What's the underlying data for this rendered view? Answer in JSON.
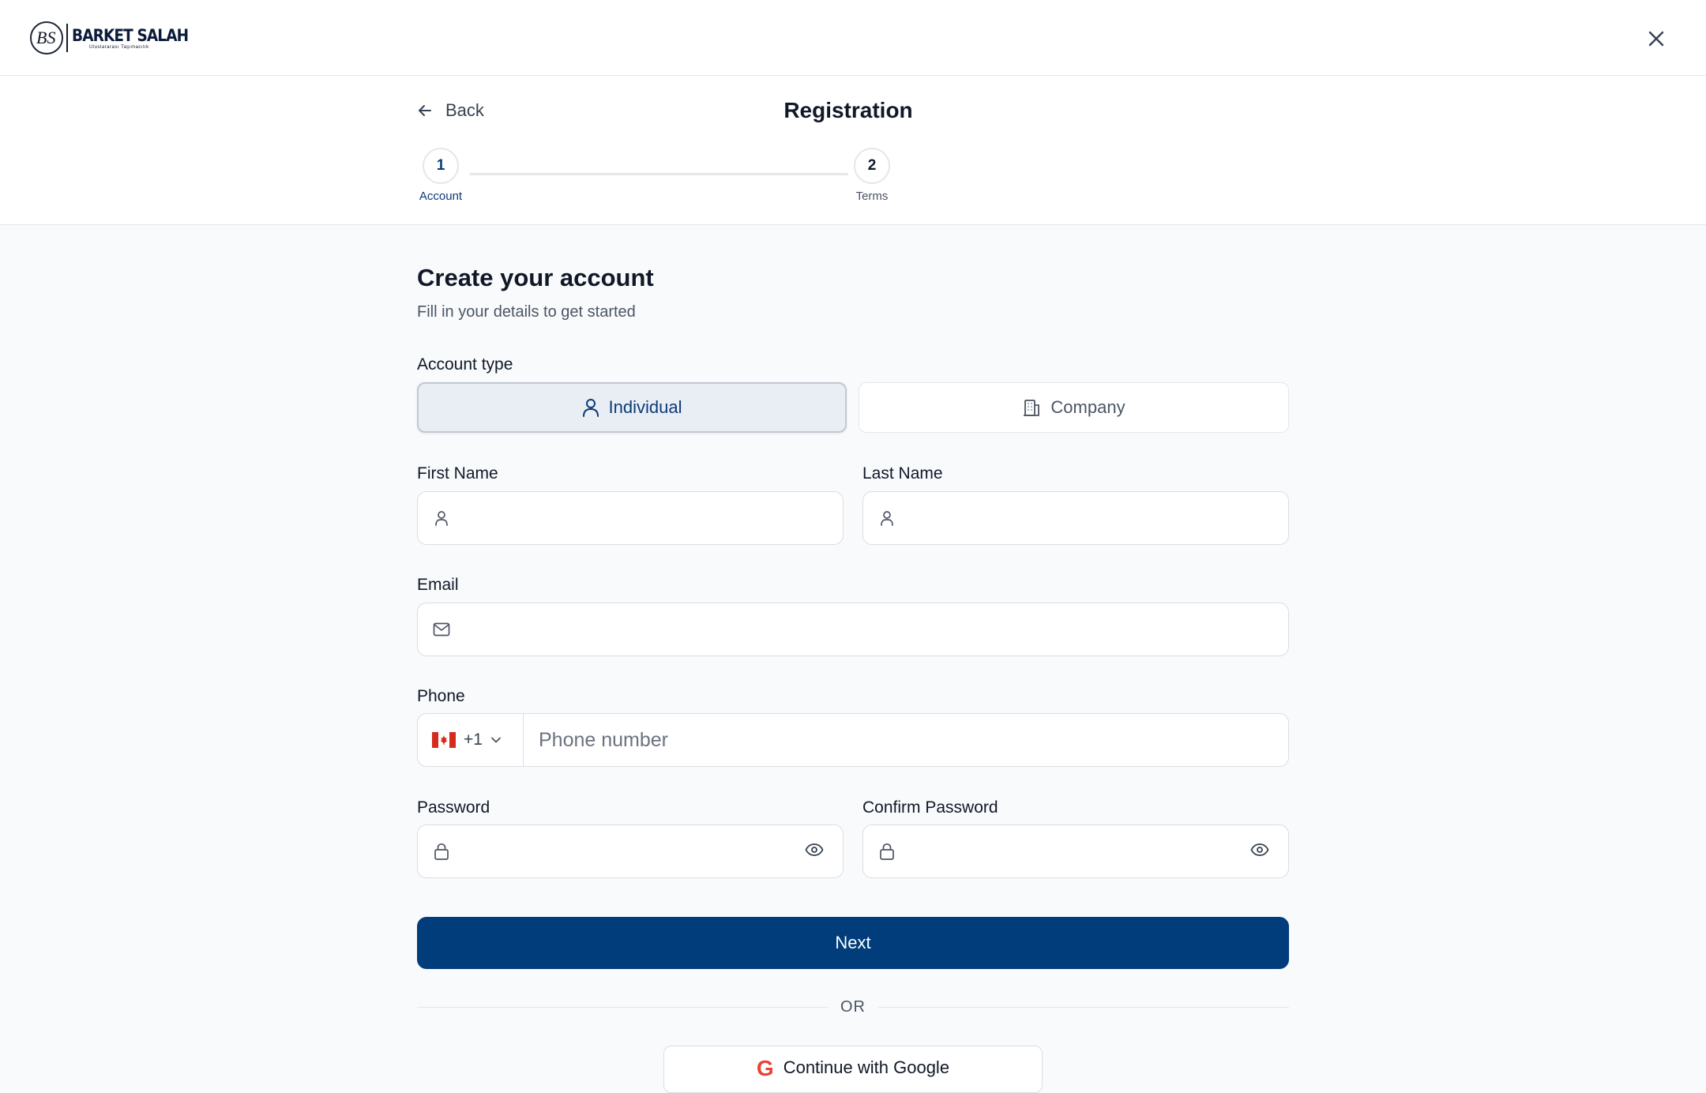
{
  "brand": {
    "name": "BARKET SALAH",
    "tagline": "Uluslararası Taşımacılık",
    "mark": "BS"
  },
  "header": {
    "back_label": "Back",
    "title": "Registration"
  },
  "stepper": {
    "steps": [
      {
        "number": "1",
        "label": "Account"
      },
      {
        "number": "2",
        "label": "Terms"
      }
    ],
    "current_step": 1
  },
  "form": {
    "heading": "Create your account",
    "subheading": "Fill in your details to get started",
    "account_type": {
      "label": "Account type",
      "options": [
        {
          "label": "Individual",
          "icon": "user-icon",
          "selected": true
        },
        {
          "label": "Company",
          "icon": "building-icon",
          "selected": false
        }
      ]
    },
    "first_name": {
      "label": "First Name",
      "value": "",
      "placeholder": ""
    },
    "last_name": {
      "label": "Last Name",
      "value": "",
      "placeholder": ""
    },
    "email": {
      "label": "Email",
      "value": "",
      "placeholder": ""
    },
    "phone": {
      "label": "Phone",
      "country_flag": "canada-flag",
      "country_code": "+1",
      "placeholder": "Phone number",
      "value": ""
    },
    "password": {
      "label": "Password",
      "value": ""
    },
    "confirm_password": {
      "label": "Confirm Password",
      "value": ""
    },
    "next_label": "Next",
    "divider_text": "OR",
    "google_label": "Continue with Google"
  },
  "colors": {
    "primary": "#003d7a",
    "selected_bg": "#e9eef4",
    "border": "#d9dee5",
    "page_bg": "#f8fafc"
  }
}
